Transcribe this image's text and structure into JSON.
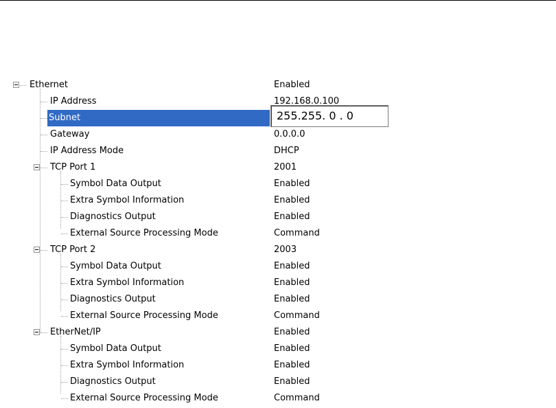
{
  "tree": {
    "rows": [
      {
        "label": "Ethernet",
        "value": "Enabled"
      },
      {
        "label": "IP Address",
        "value": "192.168.0.100"
      },
      {
        "label": "Subnet",
        "value": ""
      },
      {
        "label": "Gateway",
        "value": "0.0.0.0"
      },
      {
        "label": "IP Address Mode",
        "value": "DHCP"
      },
      {
        "label": "TCP Port 1",
        "value": "2001"
      },
      {
        "label": "Symbol Data Output",
        "value": "Enabled"
      },
      {
        "label": "Extra Symbol Information",
        "value": "Enabled"
      },
      {
        "label": "Diagnostics Output",
        "value": "Enabled"
      },
      {
        "label": "External Source Processing Mode",
        "value": "Command"
      },
      {
        "label": "TCP Port 2",
        "value": "2003"
      },
      {
        "label": "Symbol Data Output",
        "value": "Enabled"
      },
      {
        "label": "Extra Symbol Information",
        "value": "Enabled"
      },
      {
        "label": "Diagnostics Output",
        "value": "Enabled"
      },
      {
        "label": "External Source Processing Mode",
        "value": "Command"
      },
      {
        "label": "EtherNet/IP",
        "value": "Enabled"
      },
      {
        "label": "Symbol Data Output",
        "value": "Enabled"
      },
      {
        "label": "Extra Symbol Information",
        "value": "Enabled"
      },
      {
        "label": "Diagnostics Output",
        "value": "Enabled"
      },
      {
        "label": "External Source Processing Mode",
        "value": "Command"
      }
    ]
  },
  "subnet_editor": {
    "value": "255.255. 0  .  0"
  },
  "colors": {
    "selection": "#316ac5",
    "tree_lines": "#a0a0a0"
  },
  "icons": {
    "expander": "collapse-minus-icon"
  }
}
